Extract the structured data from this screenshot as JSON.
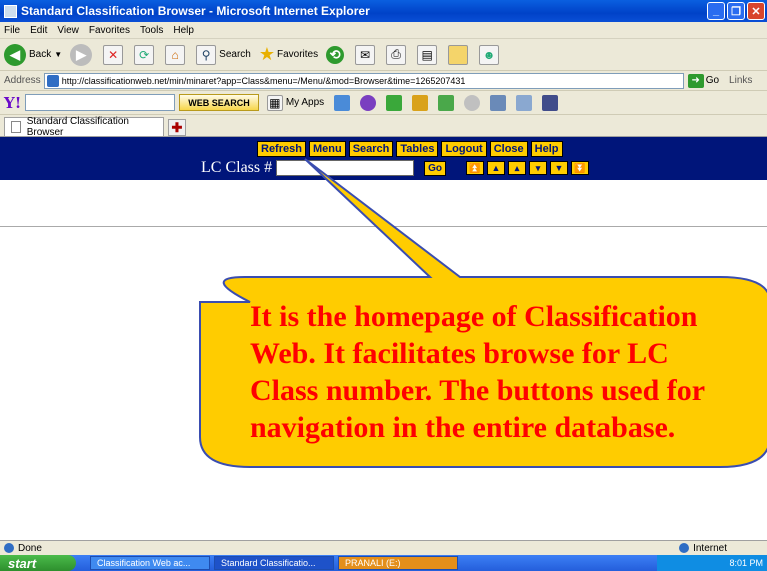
{
  "window": {
    "title": "Standard Classification Browser - Microsoft Internet Explorer"
  },
  "menu": [
    "File",
    "Edit",
    "View",
    "Favorites",
    "Tools",
    "Help"
  ],
  "toolbar": {
    "back": "Back",
    "search": "Search",
    "favorites": "Favorites"
  },
  "address": {
    "label": "Address",
    "url": "http://classificationweb.net/min/minaret?app=Class&menu=/Menu/&mod=Browser&time=1265207431",
    "go": "Go",
    "links": "Links"
  },
  "yahoo": {
    "logo": "Y!",
    "websearch": "WEB SEARCH",
    "myapps": "My Apps"
  },
  "tab": {
    "label": "Standard Classification Browser"
  },
  "page": {
    "nav_buttons": [
      "Refresh",
      "Menu",
      "Search",
      "Tables",
      "Logout",
      "Close",
      "Help"
    ],
    "lc_label": "LC Class #",
    "go": "Go"
  },
  "callout": {
    "text": "It is the homepage of Classification Web. It facilitates browse for LC Class number. The buttons used for navigation in the entire database.",
    "color": "#ff0000",
    "fill": "#ffcc00"
  },
  "status": {
    "left": "Done",
    "zone": "Internet"
  },
  "taskbar": {
    "start": "start",
    "tasks": [
      "Classification Web ac...",
      "Standard Classificatio...",
      "PRANALI (E:)"
    ],
    "clock": "8:01 PM"
  }
}
